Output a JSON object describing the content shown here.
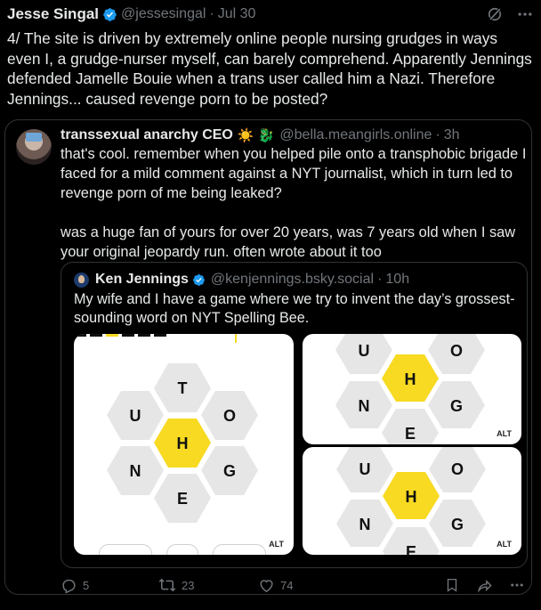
{
  "tweet": {
    "author_name": "Jesse Singal",
    "handle": "@jessesingal",
    "date": "Jul 30",
    "text": "4/ The site is driven by extremely online people nursing grudges in ways even I, a grudge-nurser myself, can barely comprehend. Apparently Jennings defended Jamelle Bouie when a trans user called him a Nazi. Therefore Jennings... caused revenge porn to be posted?"
  },
  "quote": {
    "author_name": "transsexual anarchy CEO",
    "emoji": "☀️ 🐉",
    "handle": "@bella.meangirls.online",
    "time": "3h",
    "text": "that's cool. remember when you helped pile onto a transphobic brigade I faced for a mild comment against a NYT journalist, which in turn led to revenge porn of me being leaked?\n\nwas a huge fan of yours for over 20 years, was 7 years old when I saw your original jeopardy run. often wrote about it too"
  },
  "nested_quote": {
    "author_name": "Ken Jennings",
    "handle": "@kenjennings.bsky.social",
    "time": "10h",
    "text": "My wife and I have a game where we try to invent the day’s grossest-sounding word on NYT Spelling Bee.",
    "images": [
      {
        "alt_badge": "ALT",
        "center": "H",
        "letters": [
          "T",
          "U",
          "O",
          "N",
          "G",
          "E"
        ]
      },
      {
        "alt_badge": "ALT",
        "center": "H",
        "letters": [
          "U",
          "O",
          "N",
          "G",
          "E"
        ]
      },
      {
        "alt_badge": "ALT",
        "center": "H",
        "letters": [
          "U",
          "O",
          "N",
          "G",
          "E"
        ]
      }
    ]
  },
  "actions": {
    "replies": "5",
    "reposts": "23",
    "likes": "74"
  },
  "colors": {
    "background": "#000000",
    "text": "#e7e9ea",
    "muted": "#71767b",
    "border": "#2f3336",
    "verified": "#1d9bf0",
    "hex_center": "#f7da21",
    "hex_outer": "#e6e6e6"
  }
}
